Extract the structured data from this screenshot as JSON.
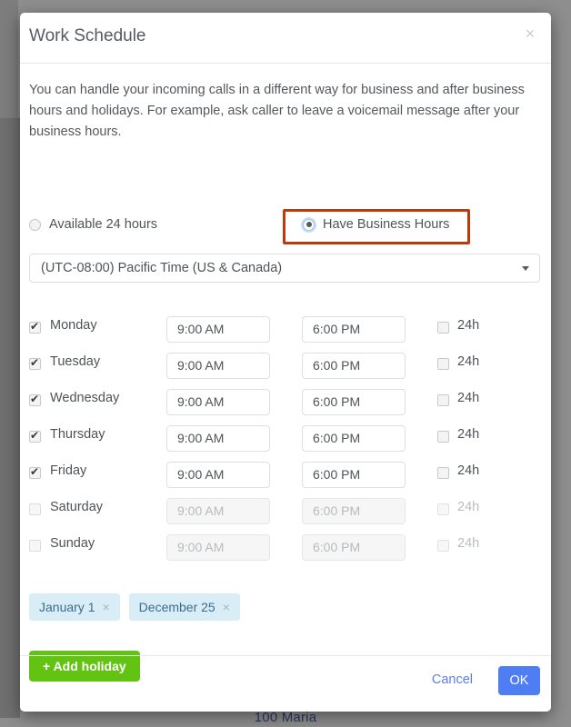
{
  "background": {
    "text": "100 Maria"
  },
  "modal": {
    "title": "Work Schedule",
    "close_icon": "close-icon",
    "close_glyph": "×",
    "intro": "You can handle your incoming calls in a different way for business and after business hours and holidays. For example, ask caller to leave a voicemail message after your business hours.",
    "mode_options": [
      {
        "label": "Available 24 hours",
        "selected": false
      },
      {
        "label": "Have Business Hours",
        "selected": true
      }
    ],
    "highlight_color": "#bf3a0b",
    "timezone": {
      "value": "(UTC-08:00) Pacific Time (US & Canada)",
      "caret_icon": "chevron-down-icon"
    },
    "schedule": {
      "h24_label": "24h",
      "rows": [
        {
          "day": "Monday",
          "enabled": true,
          "start": "9:00 AM",
          "end": "6:00 PM",
          "h24": false
        },
        {
          "day": "Tuesday",
          "enabled": true,
          "start": "9:00 AM",
          "end": "6:00 PM",
          "h24": false
        },
        {
          "day": "Wednesday",
          "enabled": true,
          "start": "9:00 AM",
          "end": "6:00 PM",
          "h24": false
        },
        {
          "day": "Thursday",
          "enabled": true,
          "start": "9:00 AM",
          "end": "6:00 PM",
          "h24": false
        },
        {
          "day": "Friday",
          "enabled": true,
          "start": "9:00 AM",
          "end": "6:00 PM",
          "h24": false
        },
        {
          "day": "Saturday",
          "enabled": false,
          "start": "9:00 AM",
          "end": "6:00 PM",
          "h24": false
        },
        {
          "day": "Sunday",
          "enabled": false,
          "start": "9:00 AM",
          "end": "6:00 PM",
          "h24": false
        }
      ]
    },
    "holidays": [
      {
        "label": "January 1",
        "remove_glyph": "×"
      },
      {
        "label": "December 25",
        "remove_glyph": "×"
      }
    ],
    "add_holiday_label": "+ Add holiday",
    "footer": {
      "cancel_label": "Cancel",
      "ok_label": "OK",
      "ok_color": "#4f7df3"
    }
  }
}
